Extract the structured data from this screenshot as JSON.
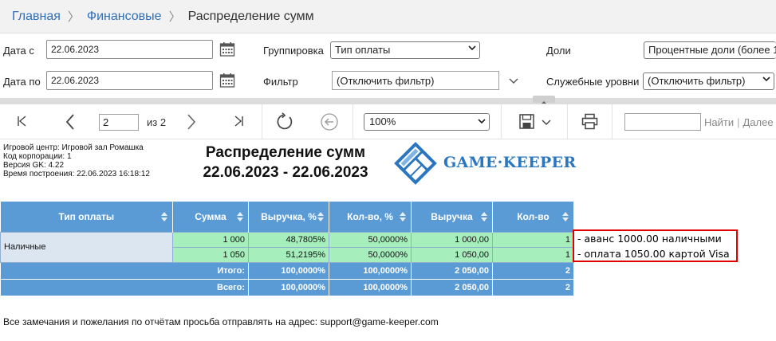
{
  "breadcrumb": {
    "items": [
      "Главная",
      "Финансовые"
    ],
    "current": "Распределение сумм"
  },
  "filters": {
    "date_from_label": "Дата с",
    "date_from_value": "22.06.2023",
    "date_to_label": "Дата по",
    "date_to_value": "22.06.2023",
    "grouping_label": "Группировка",
    "grouping_value": "Тип оплаты",
    "filter_label": "Фильтр",
    "filter_value": "(Отключить фильтр)",
    "shares_label": "Доли",
    "shares_value": "Процентные доли (более 1",
    "service_levels_label": "Служебные уровни",
    "service_levels_value": "(Отключить фильтр)"
  },
  "toolbar": {
    "page_value": "2",
    "page_of": "из 2",
    "zoom_value": "100%",
    "find_label": "Найти",
    "next_label": "Далее"
  },
  "report": {
    "meta": [
      "Игровой центр: Игровой зал Ромашка",
      "Код корпорации: 1",
      "Версия GK: 4.22",
      "Время построения: 22.06.2023 16:18:12"
    ],
    "title": "Распределение сумм",
    "period": "22.06.2023 - 22.06.2023",
    "logo_text": "GAME·KEEPER",
    "columns": [
      "Тип оплаты",
      "Сумма",
      "Выручка, %",
      "Кол-во, %",
      "Выручка",
      "Кол-во"
    ],
    "group": "Наличные",
    "rows": [
      [
        "1 000",
        "48,7805%",
        "50,0000%",
        "1 000,00",
        "1"
      ],
      [
        "1 050",
        "51,2195%",
        "50,0000%",
        "1 050,00",
        "1"
      ]
    ],
    "subtotal": [
      "Итого:",
      "100,0000%",
      "100,0000%",
      "2 050,00",
      "2"
    ],
    "total": [
      "Всего:",
      "100,0000%",
      "100,0000%",
      "2 050,00",
      "2"
    ],
    "footer": "Все замечания и пожелания по отчётам просьба отправлять на адрес: support@game-keeper.com"
  },
  "annotation": {
    "lines": [
      "- аванс 1000.00 наличными",
      "- оплата 1050.00 картой Visa"
    ]
  },
  "colors": {
    "header_blue": "#5b9bd5",
    "row_green": "#a6efbd",
    "category_blue": "#dce6f1",
    "annotation_red": "#e00000",
    "logo_blue": "#2a77c0"
  }
}
